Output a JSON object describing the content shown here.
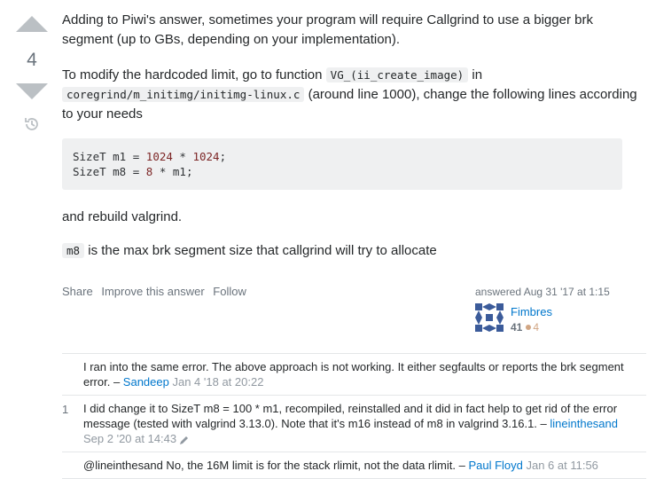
{
  "vote": {
    "count": "4"
  },
  "post": {
    "p1": "Adding to Piwi's answer, sometimes your program will require Callgrind to use a bigger brk segment (up to GBs, depending on your implementation).",
    "p2_a": "To modify the hardcoded limit, go to function ",
    "p2_code1": "VG_(ii_create_image)",
    "p2_b": " in ",
    "p2_code2": "coregrind/m_initimg/initimg-linux.c",
    "p2_c": " (around line 1000), change the following lines according to your needs",
    "code_line1": {
      "a": "SizeT m1 = ",
      "n1": "1024",
      "b": " * ",
      "n2": "1024",
      "c": ";"
    },
    "code_line2": {
      "a": "SizeT m8 = ",
      "n1": "8",
      "b": " * m1;"
    },
    "p3": "and rebuild valgrind.",
    "p4_code": "m8",
    "p4_text": " is the max brk segment size that callgrind will try to allocate"
  },
  "menu": {
    "share": "Share",
    "improve": "Improve this answer",
    "follow": "Follow"
  },
  "signature": {
    "time": "answered Aug 31 '17 at 1:15",
    "name": "Fimbres",
    "rep": "41",
    "bronze": "4"
  },
  "comments": [
    {
      "score": "",
      "text": "I ran into the same error. The above approach is not working. It either segfaults or reports the brk segment error. – ",
      "user": "Sandeep",
      "date": " Jan 4 '18 at 20:22"
    },
    {
      "score": "1",
      "text": "I did change it to SizeT m8 = 100 * m1, recompiled, reinstalled and it did in fact help to get rid of the error message (tested with valgrind 3.13.0). Note that it's m16 instead of m8 in valgrind 3.16.1. – ",
      "user": "lineinthesand",
      "date": "Sep 2 '20 at 14:43"
    },
    {
      "score": "",
      "text": "@lineinthesand No, the 16M limit is for the stack rlimit, not the data rlimit. – ",
      "user": "Paul Floyd",
      "date": " Jan 6 at 11:56"
    }
  ]
}
